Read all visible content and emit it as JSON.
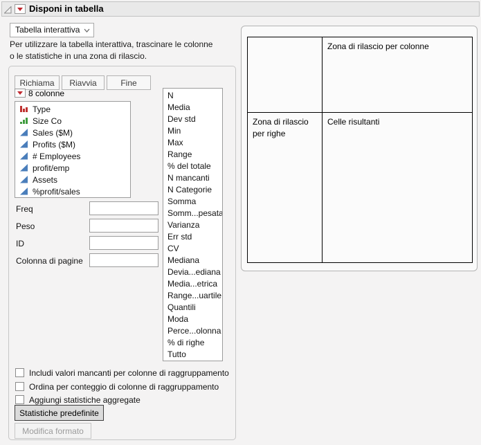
{
  "header": {
    "title": "Disponi in tabella"
  },
  "controls": {
    "mode_dropdown": {
      "value": "Tabella interattiva"
    },
    "instructions_line1": "Per utilizzare la tabella interattiva, trascinare le colonne",
    "instructions_line2": "o le statistiche in una zona di rilascio."
  },
  "left_panel": {
    "buttons": {
      "recall": "Richiama",
      "restart": "Riavvia",
      "done": "Fine"
    },
    "columns": {
      "header": "8 colonne",
      "items": [
        {
          "label": "Type",
          "icon": "nominal-bars-icon"
        },
        {
          "label": "Size Co",
          "icon": "ordinal-bars-icon"
        },
        {
          "label": "Sales ($M)",
          "icon": "continuous-triangle-icon"
        },
        {
          "label": "Profits ($M)",
          "icon": "continuous-triangle-icon"
        },
        {
          "label": "# Employees",
          "icon": "continuous-triangle-icon"
        },
        {
          "label": "profit/emp",
          "icon": "continuous-triangle-icon"
        },
        {
          "label": "Assets",
          "icon": "continuous-triangle-icon"
        },
        {
          "label": "%profit/sales",
          "icon": "continuous-triangle-icon"
        }
      ]
    },
    "fields": {
      "freq": {
        "label": "Freq",
        "value": ""
      },
      "peso": {
        "label": "Peso",
        "value": ""
      },
      "id": {
        "label": "ID",
        "value": ""
      },
      "page": {
        "label": "Colonna di pagine",
        "value": ""
      }
    },
    "stats": {
      "items": [
        "N",
        "Media",
        "Dev std",
        "Min",
        "Max",
        "Range",
        "% del totale",
        "N mancanti",
        "N Categorie",
        "Somma",
        "Somm...pesata",
        "Varianza",
        "Err std",
        "CV",
        "Mediana",
        "Devia...ediana",
        "Media...etrica",
        "Range...uartile",
        "Quantili",
        "Moda",
        "Perce...olonna",
        "% di righe",
        "Tutto"
      ]
    },
    "checkboxes": [
      {
        "label": "Includi valori mancanti per colonne di raggruppamento",
        "checked": false
      },
      {
        "label": "Ordina per conteggio di colonne di raggruppamento",
        "checked": false
      },
      {
        "label": "Aggiungi statistiche aggregate",
        "checked": false
      }
    ],
    "default_stats_button": "Statistiche predefinite",
    "change_format_button": "Modifica formato"
  },
  "drop_zones": {
    "column_zone": "Zona di rilascio per colonne",
    "row_zone": "Zona di rilascio per righe",
    "result_cells": "Celle risultanti"
  },
  "colors": {
    "accent_red_triangle": "#c0272d",
    "nominal_icon_red": "#bf3230",
    "ordinal_icon_green": "#3f9c3f",
    "continuous_icon_blue": "#4a7ebb"
  }
}
